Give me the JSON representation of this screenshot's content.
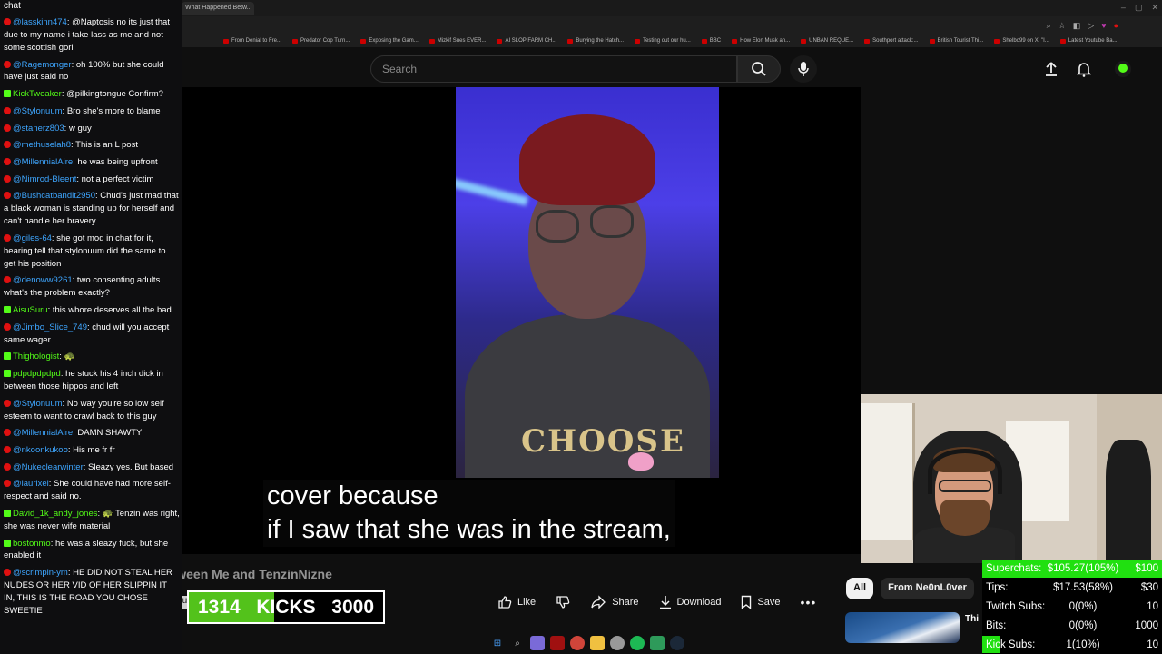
{
  "browser": {
    "active_tab": "What Happened Betw...",
    "bookmarks": [
      "From Denial to Fre...",
      "Predator Cop Turn...",
      "Exposing the Gam...",
      "Mizkif Sues EVER...",
      "AI SLOP FARM CH...",
      "Burying the Hatch...",
      "Testing out our hu...",
      "BBC",
      "How Elon Musk an...",
      "UNBAN REQUE...",
      "Southport attack:...",
      "British Tourist Thi...",
      "Shelbo99 on X: \"I...",
      "Latest Youtube Ba..."
    ]
  },
  "youtube": {
    "search_placeholder": "Search",
    "video_title": "What Happened Between Me and TenzinNizne",
    "subtitle": "cover because\nif I saw that she was in the stream,",
    "actions": {
      "like": "Like",
      "share": "Share",
      "download": "Download",
      "save": "Save"
    },
    "chips": [
      "All",
      "From Ne0nL0ver"
    ],
    "next_title": "Thi",
    "subscribe_label": "Sub"
  },
  "kicks_bar": {
    "current": "1314",
    "label": "KICKS",
    "goal": "3000",
    "progress": 0.438
  },
  "stats": [
    {
      "label": "Superchats:",
      "value": "$105.27(105%)",
      "goal": "$100",
      "progress": 1.0
    },
    {
      "label": "Tips:",
      "value": "$17.53(58%)",
      "goal": "$30",
      "progress": 0.0
    },
    {
      "label": "Twitch Subs:",
      "value": "0(0%)",
      "goal": "10",
      "progress": 0.0
    },
    {
      "label": "Bits:",
      "value": "0(0%)",
      "goal": "1000",
      "progress": 0.0
    },
    {
      "label": "Kick Subs:",
      "value": "1(10%)",
      "goal": "10",
      "progress": 0.1
    }
  ],
  "chat": {
    "title": "chat",
    "messages": [
      {
        "src": "yt",
        "user": "@lasskinn474",
        "text": "@Naptosis no its just that due to my name i take lass as me and not some scottish gorl"
      },
      {
        "src": "yt",
        "user": "@Ragemonger",
        "text": "oh 100% but she could have just said no"
      },
      {
        "src": "kick",
        "user": "KickTweaker",
        "text": "@pilkingtongue Confirm?"
      },
      {
        "src": "yt",
        "user": "@Stylonuum",
        "text": "Bro she's more to blame"
      },
      {
        "src": "yt",
        "user": "@stanerz803",
        "text": "w guy"
      },
      {
        "src": "yt",
        "user": "@methuselah8",
        "text": "This is an L post"
      },
      {
        "src": "yt",
        "user": "@MillennialAire",
        "text": "he was being upfront"
      },
      {
        "src": "yt",
        "user": "@Nimrod-Bleent",
        "text": "not a perfect victim"
      },
      {
        "src": "yt",
        "user": "@Bushcatbandit2950",
        "text": "Chud's just mad that a black woman is standing up for herself and can't handle her bravery"
      },
      {
        "src": "yt",
        "user": "@giles-64",
        "text": "she got mod in chat for it, hearing tell that stylonuum did the same to get his position"
      },
      {
        "src": "yt",
        "user": "@denoww9261",
        "text": "two consenting adults... what's the problem exactly?"
      },
      {
        "src": "kick",
        "user": "AisuSuru",
        "text": "this whore deserves all the bad"
      },
      {
        "src": "yt",
        "user": "@Jimbo_Slice_749",
        "text": "chud will you accept same wager"
      },
      {
        "src": "kick",
        "user": "Thighologist",
        "text": "🐢"
      },
      {
        "src": "kick",
        "user": "pdpdpdpdpd",
        "text": "he stuck his 4 inch dick in between those hippos and left"
      },
      {
        "src": "yt",
        "user": "@Stylonuum",
        "text": "No way you're so low self esteem to want to crawl back to this guy"
      },
      {
        "src": "yt",
        "user": "@MillennialAire",
        "text": "DAMN SHAWTY"
      },
      {
        "src": "yt",
        "user": "@nkoonkukoo",
        "text": "His me fr fr"
      },
      {
        "src": "yt",
        "user": "@Nukeclearwinter",
        "text": "Sleazy yes. But based"
      },
      {
        "src": "yt",
        "user": "@laurixel",
        "text": "She could have had more self-respect and said no."
      },
      {
        "src": "kick",
        "user": "David_1k_andy_jones",
        "text": "🐢 Tenzin was right, she was never wife material"
      },
      {
        "src": "kick",
        "user": "bostonmo",
        "text": "he was a sleazy fuck, but she enabled it"
      },
      {
        "src": "yt",
        "user": "@scrimpin-ym",
        "text": "HE DID NOT STEAL HER NUDES OR HER VID OF HER SLIPPIN IT IN, THIS IS THE ROAD YOU CHOSE SWEETIE"
      }
    ]
  },
  "colors": {
    "kick_green": "#53c21b",
    "stats_green": "#20e010",
    "yt_red": "#e01010",
    "link_blue": "#3ea6ff"
  }
}
